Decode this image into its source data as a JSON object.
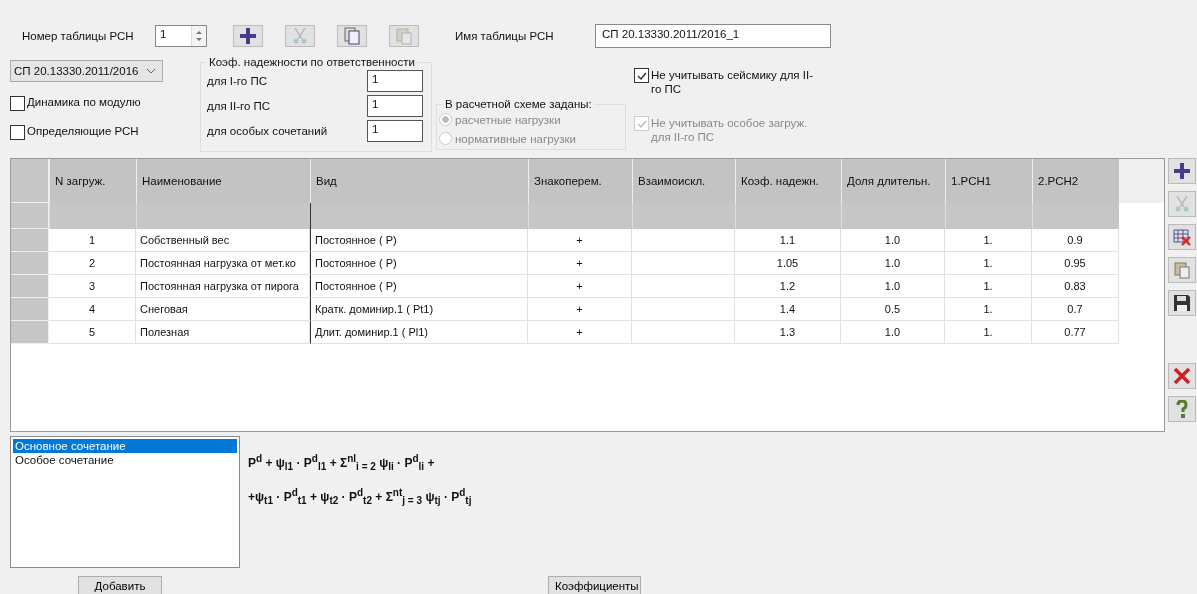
{
  "header": {
    "number_label": "Номер таблицы РСН",
    "number_value": "1",
    "name_label": "Имя таблицы РСН",
    "name_value": "СП 20.13330.2011/2016_1"
  },
  "top_tools": [
    {
      "kind": "plus",
      "disabled": false
    },
    {
      "kind": "cut",
      "disabled": true
    },
    {
      "kind": "copy",
      "disabled": false
    },
    {
      "kind": "paste",
      "disabled": true
    }
  ],
  "norm_select": "СП 20.13330.2011/2016",
  "left_checks": [
    {
      "label": "Динамика по модулю",
      "checked": false
    },
    {
      "label": "Определяющие РСН",
      "checked": false
    }
  ],
  "reliability": {
    "title": "Коэф. надежности по ответственности",
    "rows": [
      {
        "label": "для I-го ПС",
        "value": "1"
      },
      {
        "label": "для II-го ПС",
        "value": "1"
      },
      {
        "label": "для особых сочетаний",
        "value": "1"
      }
    ]
  },
  "scheme": {
    "title": "В расчетной схеме заданы:",
    "disabled": true,
    "options": [
      {
        "label": "расчетные нагрузки",
        "selected": true
      },
      {
        "label": "нормативные нагрузки",
        "selected": false
      }
    ]
  },
  "right_checks": [
    {
      "label": "Не учитывать сейсмику для II-го ПС",
      "checked": true,
      "disabled": false
    },
    {
      "label": "Не учитывать особое загруж. для II-го ПС",
      "checked": true,
      "disabled": true
    }
  ],
  "table": {
    "columns": [
      "N загруж.",
      "Наименование",
      "Вид",
      "Знакоперем.",
      "Взаимоискл.",
      "Коэф. надежн.",
      "Доля длительн.",
      "1.РСН1",
      "2.РСН2"
    ],
    "rows": [
      {
        "n": "1",
        "name": "Собственный вес",
        "type": "Постоянное ( P)",
        "sign": "+",
        "coef": "1.1",
        "share": "1.0",
        "r1": "1.",
        "r2": "0.9"
      },
      {
        "n": "2",
        "name": "Постоянная нагрузка от мет.ко",
        "type": "Постоянное ( P)",
        "sign": "+",
        "coef": "1.05",
        "share": "1.0",
        "r1": "1.",
        "r2": "0.95"
      },
      {
        "n": "3",
        "name": "Постоянная нагрузка от пирога",
        "type": "Постоянное ( P)",
        "sign": "+",
        "coef": "1.2",
        "share": "1.0",
        "r1": "1.",
        "r2": "0.83"
      },
      {
        "n": "4",
        "name": "Снеговая",
        "type": "Кратк. доминир.1 ( Pt1)",
        "sign": "+",
        "coef": "1.4",
        "share": "0.5",
        "r1": "1.",
        "r2": "0.7"
      },
      {
        "n": "5",
        "name": "Полезная",
        "type": "Длит. доминир.1 ( Pl1)",
        "sign": "+",
        "coef": "1.3",
        "share": "1.0",
        "r1": "1.",
        "r2": "0.77"
      }
    ]
  },
  "side_tools": [
    {
      "kind": "plus",
      "disabled": false
    },
    {
      "kind": "cut",
      "disabled": true
    },
    {
      "kind": "delete-grid",
      "disabled": false
    },
    {
      "kind": "paste",
      "disabled": false
    },
    {
      "kind": "save",
      "disabled": false
    },
    {
      "kind": "delete",
      "disabled": false
    },
    {
      "kind": "help",
      "disabled": false
    }
  ],
  "combinations": [
    {
      "label": "Основное сочетание",
      "selected": true
    },
    {
      "label": "Особое сочетание",
      "selected": false
    }
  ],
  "formula": [
    "P$^{d}$ + ψ$_{l1}$ · P$^{d}$$_{l1}$ + Σ$^{nl}$$_{i = 2}$ ψ$_{li}$ · P$^{d}$$_{li}$ +",
    "+ψ$_{t1}$ · P$^{d}$$_{t1}$ + ψ$_{t2}$ · P$^{d}$$_{t2}$ + Σ$^{nt}$$_{j = 3}$ ψ$_{tj}$ · P$^{d}$$_{tj}$"
  ],
  "buttons": [
    "Добавить",
    "Коэффициенты"
  ]
}
